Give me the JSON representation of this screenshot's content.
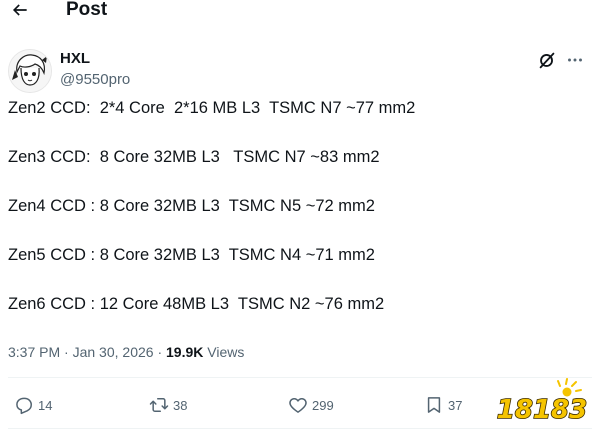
{
  "header": {
    "back_icon": "arrow-left-icon",
    "title": "Post"
  },
  "author": {
    "name": "HXL",
    "handle": "@9550pro",
    "avatar": "anime-avatar"
  },
  "top_actions": {
    "grok_icon": "grok-icon",
    "more_icon": "more-horizontal-icon"
  },
  "post": {
    "lines": [
      "Zen2 CCD:  2*4 Core  2*16 MB L3  TSMC N7 ~77 mm2",
      "Zen3 CCD:  8 Core 32MB L3   TSMC N7 ~83 mm2",
      "Zen4 CCD : 8 Core 32MB L3  TSMC N5 ~72 mm2",
      "Zen5 CCD : 8 Core 32MB L3  TSMC N4 ~71 mm2",
      "Zen6 CCD : 12 Core 48MB L3  TSMC N2 ~76 mm2"
    ]
  },
  "meta": {
    "time": "3:37 PM",
    "separator1": " · ",
    "date": "Jan 30, 2026",
    "separator2": " · ",
    "views_count": "19.9K",
    "views_label": " Views"
  },
  "actions": {
    "replies": {
      "icon": "reply-icon",
      "count": "14"
    },
    "reposts": {
      "icon": "repost-icon",
      "count": "38"
    },
    "likes": {
      "icon": "heart-icon",
      "count": "299"
    },
    "bookmarks": {
      "icon": "bookmark-icon",
      "count": "37"
    }
  },
  "watermark": {
    "text": "18183"
  },
  "colors": {
    "text": "#0f1419",
    "secondary": "#536471",
    "divider": "#eff3f4",
    "watermark_yellow": "#f5c400"
  }
}
